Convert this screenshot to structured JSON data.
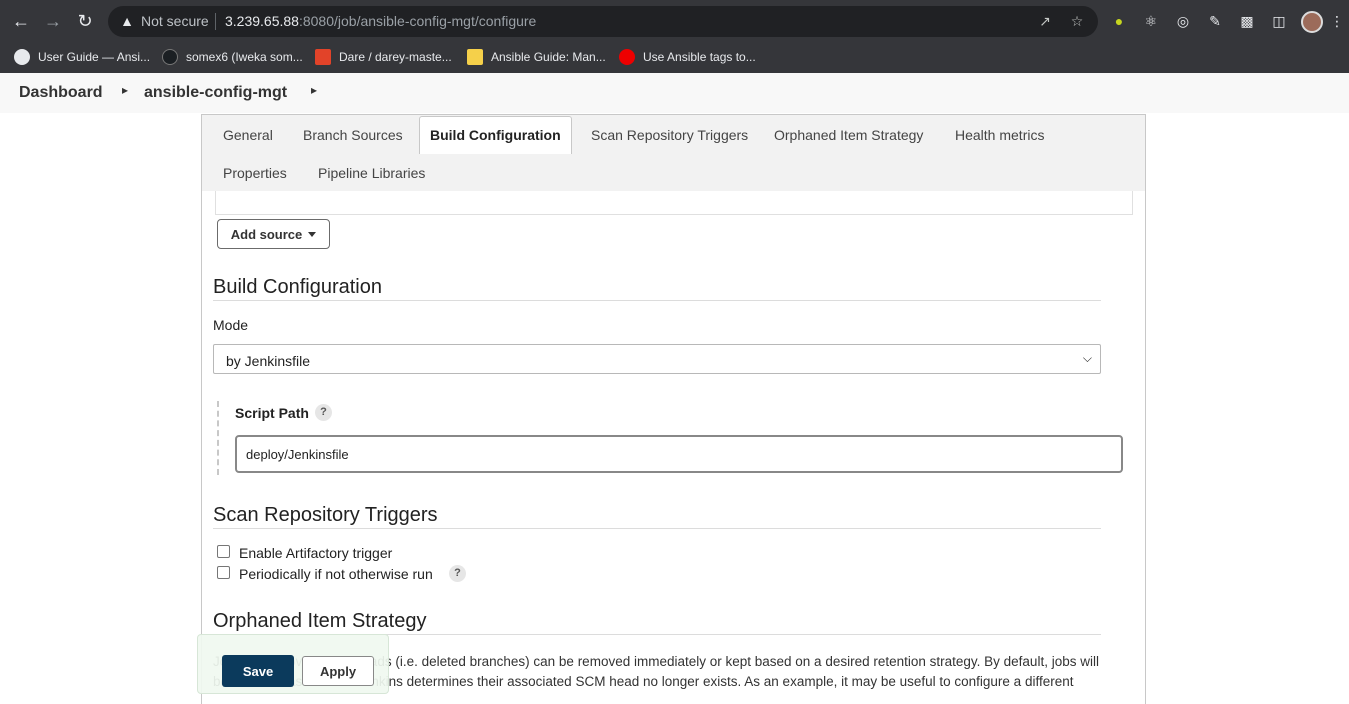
{
  "browser": {
    "security_label": "Not secure",
    "url_host": "3.239.65.88",
    "url_rest": ":8080/job/ansible-config-mgt/configure"
  },
  "bookmarks": [
    {
      "label": "User Guide — Ansi...",
      "icon": "globe-icon",
      "color": "#e8eaed"
    },
    {
      "label": "somex6 (Iweka som...",
      "icon": "github-icon",
      "color": "#1b1f23"
    },
    {
      "label": "Dare / darey-maste...",
      "icon": "gitlab-icon",
      "color": "#e24329"
    },
    {
      "label": "Ansible Guide: Man...",
      "icon": "bulb-icon",
      "color": "#f5d04a"
    },
    {
      "label": "Use Ansible tags to...",
      "icon": "redhat-icon",
      "color": "#ee0000"
    }
  ],
  "breadcrumb": {
    "dashboard": "Dashboard",
    "job": "ansible-config-mgt"
  },
  "tabs": [
    {
      "label": "General"
    },
    {
      "label": "Branch Sources"
    },
    {
      "label": "Build Configuration"
    },
    {
      "label": "Scan Repository Triggers"
    },
    {
      "label": "Orphaned Item Strategy"
    },
    {
      "label": "Health metrics"
    },
    {
      "label": "Properties"
    },
    {
      "label": "Pipeline Libraries"
    }
  ],
  "active_tab": "Build Configuration",
  "add_source_label": "Add source",
  "build_config": {
    "title": "Build Configuration",
    "mode_label": "Mode",
    "mode_value": "by Jenkinsfile",
    "script_path_label": "Script Path",
    "script_path_value": "deploy/Jenkinsfile"
  },
  "scan_triggers": {
    "title": "Scan Repository Triggers",
    "options": [
      {
        "label": "Enable Artifactory trigger",
        "checked": false
      },
      {
        "label": "Periodically if not otherwise run",
        "checked": false
      }
    ]
  },
  "orphaned": {
    "title": "Orphaned Item Strategy",
    "desc_line1": "Jobs for removed SCM heads (i.e. deleted branches) can be removed immediately or kept based on a desired retention strategy. By default, jobs will",
    "desc_line2": "be removed as soon as Jenkins determines their associated SCM head no longer exists. As an example, it may be useful to configure a different"
  },
  "help_glyph": "?",
  "buttons": {
    "save": "Save",
    "apply": "Apply"
  },
  "colors": {
    "save_bg": "#0b3a5c",
    "chrome_bg": "#35363a"
  }
}
